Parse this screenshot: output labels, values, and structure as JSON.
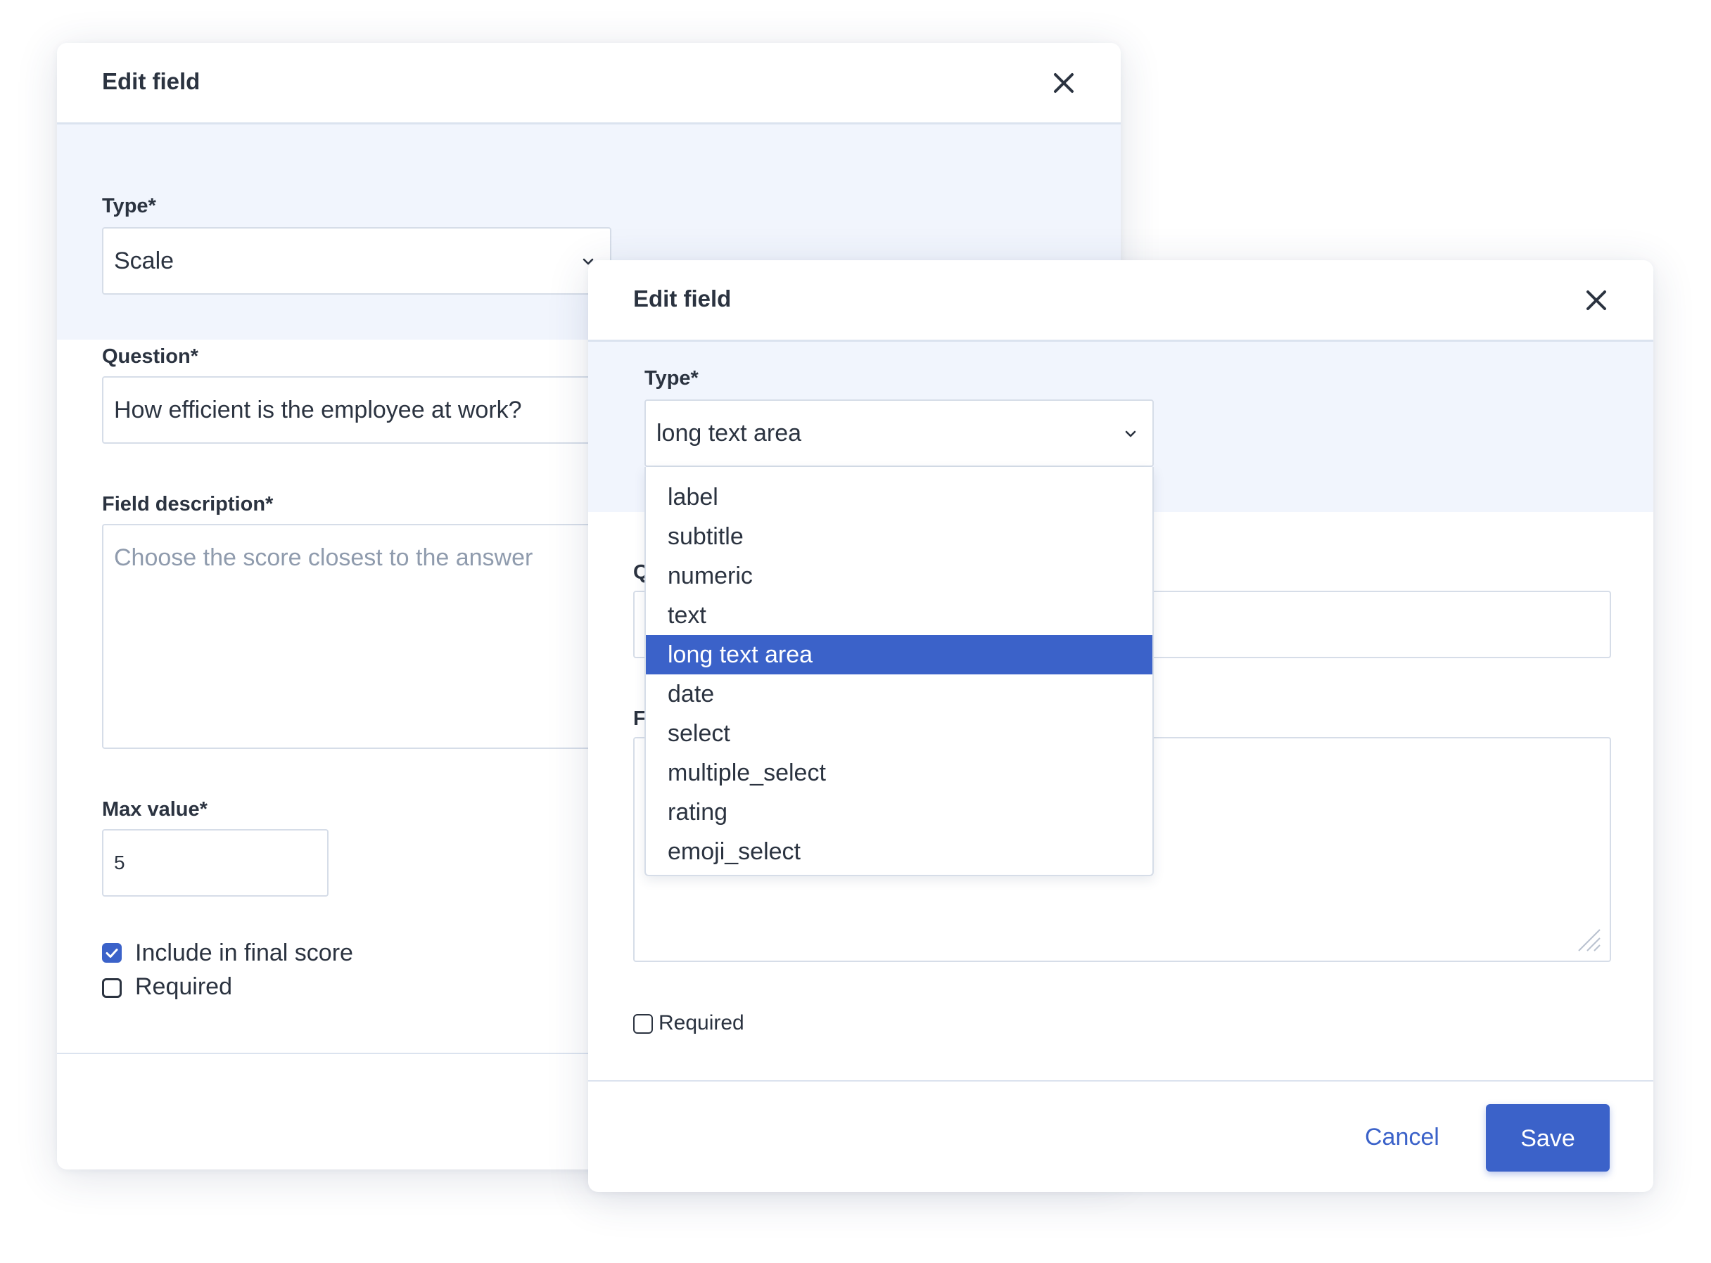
{
  "back_dialog": {
    "title": "Edit field",
    "type_label": "Type*",
    "type_value": "Scale",
    "question_label": "Question*",
    "question_value": "How efficient is the employee at work?",
    "description_label": "Field description*",
    "description_placeholder": "Choose the score closest to the answer",
    "max_value_label": "Max value*",
    "max_value": "5",
    "include_label": "Include in final score",
    "include_checked": true,
    "required_label": "Required",
    "required_checked": false
  },
  "front_dialog": {
    "title": "Edit field",
    "type_label": "Type*",
    "type_value": "long text area",
    "question_label_partial": "Q",
    "description_label_partial": "F",
    "required_label": "Required",
    "required_checked": false,
    "cancel_label": "Cancel",
    "save_label": "Save",
    "dropdown": {
      "options": [
        "label",
        "subtitle",
        "numeric",
        "text",
        "long text area",
        "date",
        "select",
        "multiple_select",
        "rating",
        "emoji_select"
      ],
      "selected": "long text area"
    }
  },
  "icons": {
    "close": "close-icon",
    "chevron": "chevron-down-icon",
    "check": "checkmark-icon",
    "resize": "resize-handle-icon"
  },
  "colors": {
    "accent": "#3b62c9",
    "tinted_bg": "#f1f5fd",
    "text": "#2b3340",
    "placeholder": "#8f9bad",
    "border": "#d6dde8"
  }
}
